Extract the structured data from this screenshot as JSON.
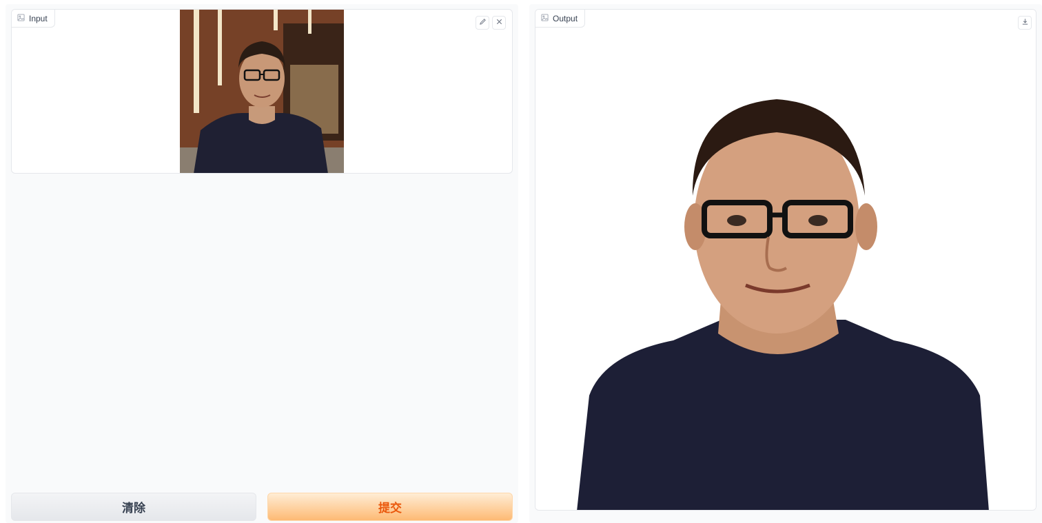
{
  "input_panel": {
    "label": "Input",
    "image_icon": "image-icon",
    "edit_icon": "pencil-icon",
    "clear_icon": "close-icon"
  },
  "output_panel": {
    "label": "Output",
    "image_icon": "image-icon",
    "download_icon": "download-icon"
  },
  "buttons": {
    "clear_label": "清除",
    "submit_label": "提交"
  },
  "colors": {
    "submit_text": "#ea580c",
    "submit_bg_start": "#ffedd5",
    "submit_bg_end": "#fdba74",
    "clear_bg": "#e5e7eb"
  }
}
